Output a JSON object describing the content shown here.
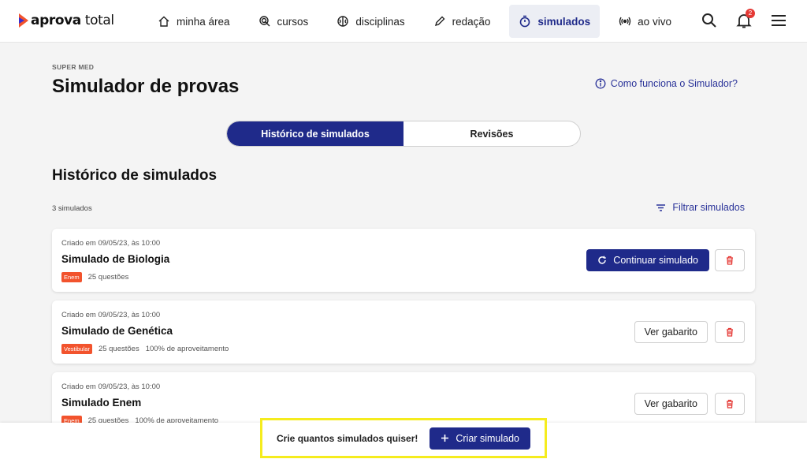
{
  "brand": {
    "name_bold": "aprova",
    "name_light": " total"
  },
  "nav": {
    "items": [
      {
        "label": "minha área",
        "icon": "home-icon"
      },
      {
        "label": "cursos",
        "icon": "cursor-click-icon"
      },
      {
        "label": "disciplinas",
        "icon": "brain-icon"
      },
      {
        "label": "redação",
        "icon": "pencil-icon"
      },
      {
        "label": "simulados",
        "icon": "stopwatch-icon",
        "active": true
      },
      {
        "label": "ao vivo",
        "icon": "broadcast-icon"
      }
    ],
    "notifications_count": "2"
  },
  "header": {
    "eyebrow": "SUPER MED",
    "title": "Simulador de provas",
    "help_link": "Como funciona o Simulador?"
  },
  "tabs": [
    {
      "label": "Histórico de simulados",
      "active": true
    },
    {
      "label": "Revisões",
      "active": false
    }
  ],
  "section": {
    "title": "Histórico de simulados",
    "count": "3 simulados",
    "filter_label": "Filtrar simulados"
  },
  "cards": [
    {
      "date": "Criado em 09/05/23, às 10:00",
      "title": "Simulado de Biologia",
      "tag": "Enem",
      "questions": "25 questões",
      "performance": "",
      "action": "Continuar simulado"
    },
    {
      "date": "Criado em 09/05/23, às 10:00",
      "title": "Simulado de Genética",
      "tag": "Vestibular",
      "questions": "25 questões",
      "performance": "100% de aproveitamento",
      "action": "Ver gabarito"
    },
    {
      "date": "Criado em 09/05/23, às 10:00",
      "title": "Simulado Enem",
      "tag": "Enem",
      "questions": "25 questões",
      "performance": "100% de aproveitamento",
      "action": "Ver gabarito"
    }
  ],
  "cta": {
    "text": "Crie quantos simulados quiser!",
    "button": "Criar simulado"
  },
  "colors": {
    "primary": "#1f2a8a",
    "tag": "#f2532d",
    "danger": "#e53935",
    "highlight": "#f5ec1e"
  }
}
